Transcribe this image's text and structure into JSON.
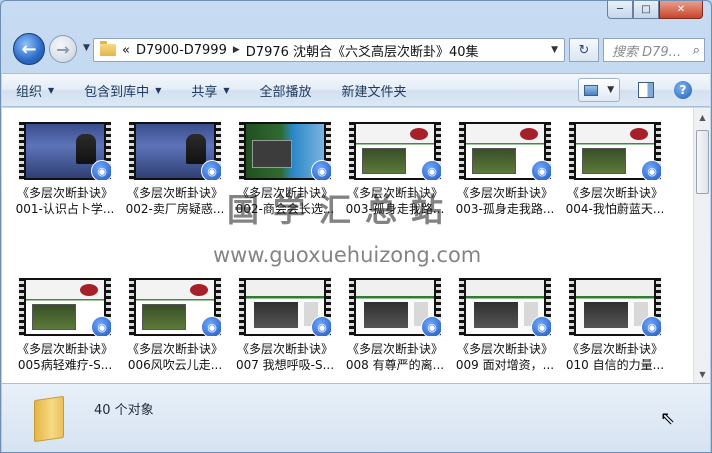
{
  "window": {
    "caption_min": "─",
    "caption_max": "□",
    "caption_close": "✕"
  },
  "nav": {
    "back": "←",
    "forward": "→",
    "address_prefix": "«",
    "breadcrumbs": [
      "D7900-D7999",
      "D7976 沈朝合《六爻高层次断卦》40集"
    ],
    "search_placeholder": "搜索 D79..."
  },
  "toolbar": {
    "items": [
      {
        "label": "组织",
        "dropdown": true
      },
      {
        "label": "包含到库中",
        "dropdown": true
      },
      {
        "label": "共享",
        "dropdown": true
      },
      {
        "label": "全部播放",
        "dropdown": false
      },
      {
        "label": "新建文件夹",
        "dropdown": false
      }
    ],
    "help": "?"
  },
  "files": [
    {
      "line1": "《多层次断卦诀》",
      "line2": "001-认识占卜学...",
      "thumb": "lecture"
    },
    {
      "line1": "《多层次断卦诀》",
      "line2": "002-卖厂房疑惑...",
      "thumb": "lecture"
    },
    {
      "line1": "《多层次断卦诀》",
      "line2": "002-商会会长选...",
      "thumb": "green"
    },
    {
      "line1": "《多层次断卦诀》",
      "line2": "003-孤身走我路...",
      "thumb": "slide"
    },
    {
      "line1": "《多层次断卦诀》",
      "line2": "003-孤身走我路...",
      "thumb": "slide"
    },
    {
      "line1": "《多层次断卦诀》",
      "line2": "004-我怕蔚蓝天...",
      "thumb": "slide"
    },
    {
      "line1": "《多层次断卦诀》",
      "line2": "005病轻难疗-S...",
      "thumb": "slide"
    },
    {
      "line1": "《多层次断卦诀》",
      "line2": "006风吹云儿走...",
      "thumb": "slide"
    },
    {
      "line1": "《多层次断卦诀》",
      "line2": "007 我想呼吸-S...",
      "thumb": "board"
    },
    {
      "line1": "《多层次断卦诀》",
      "line2": "008 有尊严的离...",
      "thumb": "board"
    },
    {
      "line1": "《多层次断卦诀》",
      "line2": "009 面对增资，...",
      "thumb": "board"
    },
    {
      "line1": "《多层次断卦诀》",
      "line2": "010 自信的力量...",
      "thumb": "board"
    }
  ],
  "status": {
    "count_text": "40 个对象"
  },
  "watermark": {
    "line1": "国学汇总站",
    "line2": "www.guoxuehuizong.com"
  }
}
